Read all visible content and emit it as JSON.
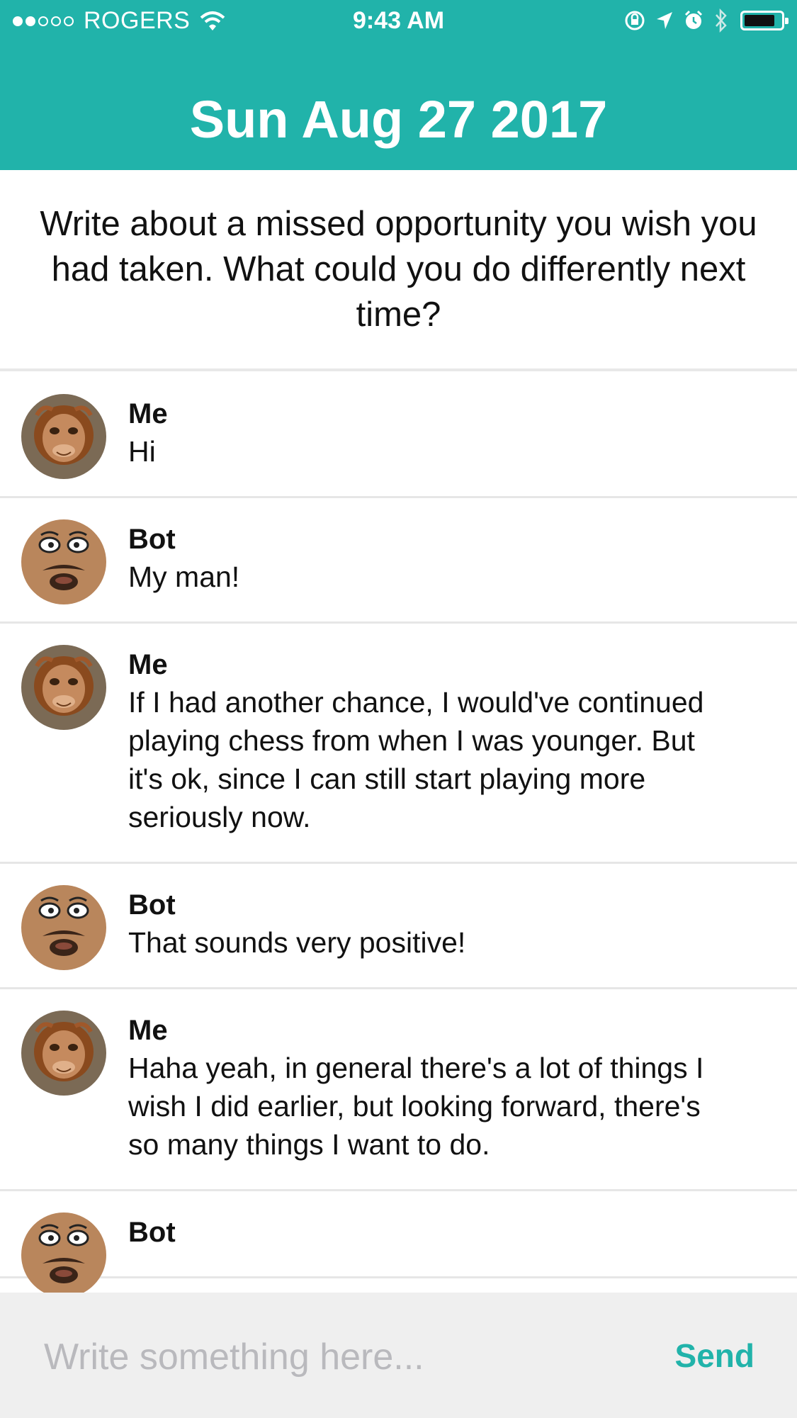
{
  "status_bar": {
    "carrier": "ROGERS",
    "time": "9:43 AM",
    "signal_dots_filled": 2,
    "signal_dots_total": 5,
    "battery_level": 0.85
  },
  "header": {
    "title": "Sun Aug 27 2017",
    "background_color": "#21b3aa"
  },
  "prompt": {
    "text": "Write about a missed opportunity you wish you had taken. What could you do differently next time?"
  },
  "messages": [
    {
      "sender": "Me",
      "avatar": "orangutan-avatar",
      "text": "Hi"
    },
    {
      "sender": "Bot",
      "avatar": "cartoon-face-avatar",
      "text": "My man!"
    },
    {
      "sender": "Me",
      "avatar": "orangutan-avatar",
      "text": "If I had another chance, I would've continued playing chess from when I was younger. But it's ok, since I can still start playing more seriously now."
    },
    {
      "sender": "Bot",
      "avatar": "cartoon-face-avatar",
      "text": "That sounds very positive!"
    },
    {
      "sender": "Me",
      "avatar": "orangutan-avatar",
      "text": "Haha yeah, in general there's a lot of things I wish I did earlier, but looking forward, there's so many things I want to do."
    },
    {
      "sender": "Bot",
      "avatar": "cartoon-face-avatar",
      "text": ""
    }
  ],
  "composer": {
    "placeholder": "Write something here...",
    "value": "",
    "send_label": "Send",
    "accent_color": "#21b3aa"
  }
}
